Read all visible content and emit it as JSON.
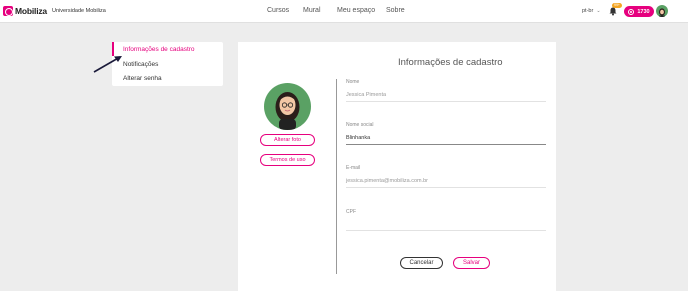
{
  "brand": {
    "name": "Mobiliza",
    "org": "Universidade Mobiliza",
    "accent": "#e6007e"
  },
  "nav": {
    "items": [
      "Cursos",
      "Mural",
      "Meu espaço",
      "Sobre"
    ]
  },
  "header": {
    "lang": "pt-br",
    "notif_badge": "99+",
    "points": "1730"
  },
  "sidebar": {
    "items": [
      {
        "label": "Informações de cadastro",
        "active": true
      },
      {
        "label": "Notificações"
      },
      {
        "label": "Alterar senha"
      }
    ]
  },
  "card": {
    "title": "Informações de cadastro",
    "change_photo": "Alterar foto",
    "terms": "Termos de uso",
    "fields": {
      "nome_label": "Nome",
      "nome_value": "Jessica Pimenta",
      "social_label": "Nome social",
      "social_value": "Blinhanka",
      "email_label": "E-mail",
      "email_value": "jessica.pimenta@mobiliza.com.br",
      "cpf_label": "CPF",
      "cpf_value": ""
    },
    "cancel": "Cancelar",
    "save": "Salvar"
  }
}
